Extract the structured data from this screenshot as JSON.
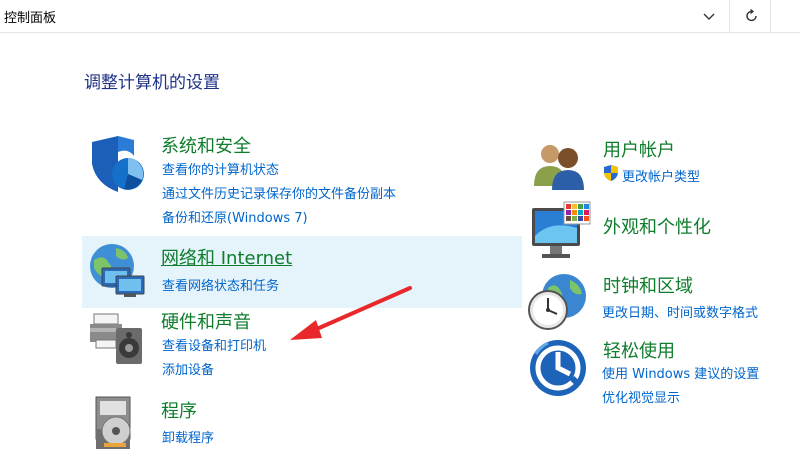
{
  "address_bar": {
    "text": "控制面板"
  },
  "page_title": "调整计算机的设置",
  "left": [
    {
      "title": "系统和安全",
      "icon": "shield-security-icon",
      "links": [
        "查看你的计算机状态",
        "通过文件历史记录保存你的文件备份副本",
        "备份和还原(Windows 7)"
      ]
    },
    {
      "title": "网络和 Internet",
      "icon": "network-globe-icon",
      "links": [
        "查看网络状态和任务"
      ]
    },
    {
      "title": "硬件和声音",
      "icon": "printer-speaker-icon",
      "links": [
        "查看设备和打印机",
        "添加设备"
      ]
    },
    {
      "title": "程序",
      "icon": "programs-disc-icon",
      "links": [
        "卸载程序"
      ]
    }
  ],
  "right": [
    {
      "title": "用户帐户",
      "icon": "users-icon",
      "links": [
        "更改帐户类型"
      ]
    },
    {
      "title": "外观和个性化",
      "icon": "monitor-palette-icon",
      "links": []
    },
    {
      "title": "时钟和区域",
      "icon": "clock-globe-icon",
      "links": [
        "更改日期、时间或数字格式"
      ]
    },
    {
      "title": "轻松使用",
      "icon": "ease-of-access-icon",
      "links": [
        "使用 Windows 建议的设置",
        "优化视觉显示"
      ]
    }
  ],
  "colors": {
    "category_title": "#0f7d2c",
    "link": "#0066cc",
    "page_title": "#1e3287",
    "hover_highlight": "#e5f3fb",
    "annotation_arrow": "#e8282a"
  }
}
